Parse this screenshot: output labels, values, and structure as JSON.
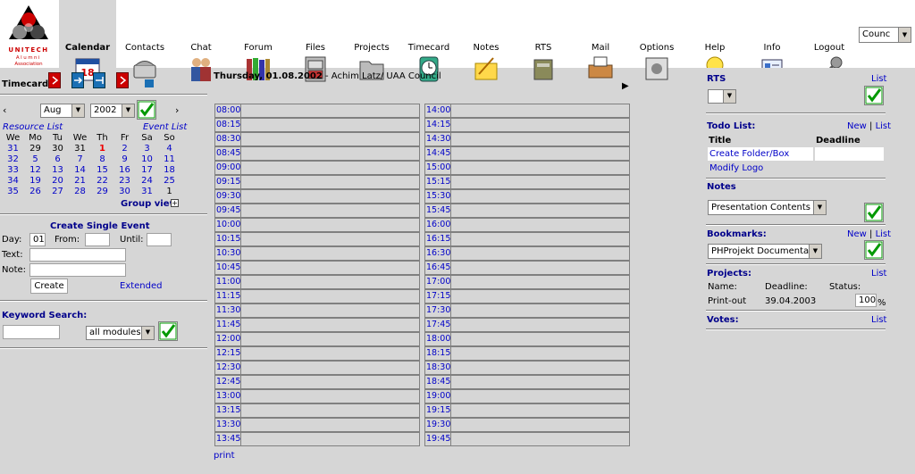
{
  "nav": {
    "logo_text": "UNITECH Alumni Association",
    "items": [
      {
        "label": "Calendar",
        "icon": "calendar-icon",
        "active": true
      },
      {
        "label": "Contacts",
        "icon": "phone-icon",
        "active": false
      },
      {
        "label": "Chat",
        "icon": "chat-people-icon",
        "active": false
      },
      {
        "label": "Forum",
        "icon": "books-icon",
        "active": false
      },
      {
        "label": "Files",
        "icon": "file-cabinet-icon",
        "active": false
      },
      {
        "label": "Projects",
        "icon": "folder-icon",
        "active": false
      },
      {
        "label": "Timecard",
        "icon": "clock-icon",
        "active": false
      },
      {
        "label": "Notes",
        "icon": "notepad-icon",
        "active": false
      },
      {
        "label": "RTS",
        "icon": "box-icon",
        "active": false
      },
      {
        "label": "Mail",
        "icon": "mailbox-icon",
        "active": false
      },
      {
        "label": "Options",
        "icon": "options-icon",
        "active": false
      },
      {
        "label": "Help",
        "icon": "lightbulb-icon",
        "active": false
      },
      {
        "label": "Info",
        "icon": "id-card-icon",
        "active": false
      },
      {
        "label": "Logout",
        "icon": "key-icon",
        "active": false
      }
    ],
    "group_select": "Counc"
  },
  "left": {
    "timecard_label": "Timecard",
    "month": "Aug",
    "year": "2002",
    "resource_list": "Resource List",
    "event_list": "Event List",
    "weekdays": [
      "We",
      "Mo",
      "Tu",
      "We",
      "Th",
      "Fr",
      "Sa",
      "So"
    ],
    "weeks": [
      [
        "31",
        "29",
        "30",
        "31",
        "1",
        "2",
        "3",
        "4"
      ],
      [
        "32",
        "5",
        "6",
        "7",
        "8",
        "9",
        "10",
        "11"
      ],
      [
        "33",
        "12",
        "13",
        "14",
        "15",
        "16",
        "17",
        "18"
      ],
      [
        "34",
        "19",
        "20",
        "21",
        "22",
        "23",
        "24",
        "25"
      ],
      [
        "35",
        "26",
        "27",
        "28",
        "29",
        "30",
        "31",
        "1"
      ]
    ],
    "group_view": "Group view",
    "create_single_event": "Create Single Event",
    "day_label": "Day:",
    "day_value": "01",
    "from_label": "From:",
    "until_label": "Until:",
    "text_label": "Text:",
    "note_label": "Note:",
    "create_button": "Create",
    "extended": "Extended",
    "keyword_search": "Keyword Search:",
    "modules_select": "all modules"
  },
  "mid": {
    "date": "Thursday, 01.08.2002",
    "user": " - Achim Latz/ UAA Council",
    "times_left": [
      "08:00",
      "08:15",
      "08:30",
      "08:45",
      "09:00",
      "09:15",
      "09:30",
      "09:45",
      "10:00",
      "10:15",
      "10:30",
      "10:45",
      "11:00",
      "11:15",
      "11:30",
      "11:45",
      "12:00",
      "12:15",
      "12:30",
      "12:45",
      "13:00",
      "13:15",
      "13:30",
      "13:45"
    ],
    "times_right": [
      "14:00",
      "14:15",
      "14:30",
      "14:45",
      "15:00",
      "15:15",
      "15:30",
      "15:45",
      "16:00",
      "16:15",
      "16:30",
      "16:45",
      "17:00",
      "17:15",
      "17:30",
      "17:45",
      "18:00",
      "18:15",
      "18:30",
      "18:45",
      "19:00",
      "19:15",
      "19:30",
      "19:45"
    ],
    "print": "print"
  },
  "right": {
    "rts_title": "RTS",
    "rts_list": "List",
    "todo_title": "Todo List:",
    "todo_new": "New",
    "todo_sep": "|",
    "todo_list": "List",
    "todo_col_title": "Title",
    "todo_col_deadline": "Deadline",
    "todo_rows": [
      "Create Folder/Box",
      "Modify Logo"
    ],
    "notes_title": "Notes",
    "notes_select": "Presentation Contents",
    "bookmarks_title": "Bookmarks:",
    "bookmarks_new": "New",
    "bookmarks_sep": "|",
    "bookmarks_list": "List",
    "bookmarks_select": "PHProjekt Documentatio",
    "projects_title": "Projects:",
    "projects_list": "List",
    "proj_name_label": "Name:",
    "proj_deadline_label": "Deadline:",
    "proj_status_label": "Status:",
    "proj_name": "Print-out",
    "proj_deadline": "39.04.2003",
    "proj_status": "100",
    "proj_pct": "%",
    "votes_title": "Votes:",
    "votes_list": "List"
  }
}
